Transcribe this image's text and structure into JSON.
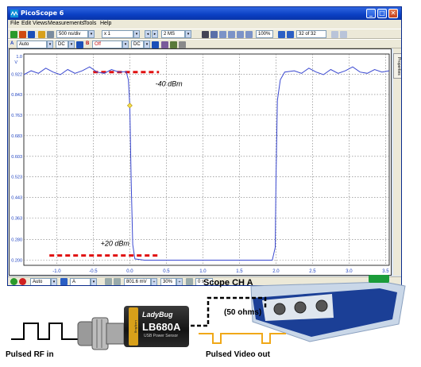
{
  "window": {
    "title": "PicoScope 6",
    "buttons": [
      "_",
      "□",
      "✕"
    ]
  },
  "menu": [
    "File",
    "Edit",
    "Views",
    "Measurements",
    "Tools",
    "Help"
  ],
  "toolbar1": {
    "timebase": "500 ns/div",
    "zoom": "x 1",
    "samples": "2 MS",
    "zoom_percent": "100%",
    "capture_counter": "32 of 32"
  },
  "toolbar2": {
    "channel_a_label": "A",
    "channel_a_range": "Auto",
    "channel_a_coupling": "DC",
    "channel_b_label": "B",
    "channel_b_range": "Off",
    "channel_b_coupling": "DC"
  },
  "side_tab": "Properties",
  "statusbar": {
    "trigger_mode": "Auto",
    "trigger_channel": "A",
    "trigger_level": "801.6 mV",
    "pretrigger": "30%",
    "delay": "0 s"
  },
  "chart_data": {
    "type": "line",
    "x_ticks": [
      "-1.0",
      "-0.5",
      "0.0",
      "0.5",
      "1.0",
      "1.5",
      "2.0",
      "2.5",
      "3.0",
      "3.5"
    ],
    "y_ticks": [
      "0.922",
      "0.843",
      "0.763",
      "0.683",
      "0.603",
      "0.523",
      "0.443",
      "0.363",
      "0.280",
      "0.200"
    ],
    "y_top_label": "1.0",
    "y_unit": "V",
    "xlim": [
      -1.45,
      3.55
    ],
    "ylim": [
      0.18,
      1.0
    ],
    "grid": true,
    "series": [
      {
        "color": "#3a48d0",
        "x": [
          -1.45,
          -1.35,
          -1.25,
          -1.15,
          -1.05,
          -0.95,
          -0.85,
          -0.75,
          -0.65,
          -0.55,
          -0.45,
          -0.35,
          -0.25,
          -0.15,
          -0.05,
          -0.02,
          0.0,
          0.02,
          0.04,
          0.07,
          0.2,
          0.6,
          1.0,
          1.5,
          1.95,
          1.99,
          2.0,
          2.02,
          2.06,
          2.12,
          2.25,
          2.35,
          2.45,
          2.55,
          2.65,
          2.75,
          2.85,
          2.95,
          3.05,
          3.15,
          3.25,
          3.35,
          3.45,
          3.55
        ],
        "y": [
          0.92,
          0.935,
          0.925,
          0.945,
          0.93,
          0.92,
          0.94,
          0.925,
          0.935,
          0.95,
          0.93,
          0.925,
          0.94,
          0.93,
          0.932,
          0.9,
          0.8,
          0.5,
          0.26,
          0.205,
          0.2,
          0.2,
          0.2,
          0.2,
          0.2,
          0.25,
          0.5,
          0.82,
          0.9,
          0.93,
          0.935,
          0.925,
          0.945,
          0.93,
          0.92,
          0.94,
          0.925,
          0.935,
          0.95,
          0.93,
          0.925,
          0.94,
          0.93,
          0.935
        ]
      }
    ],
    "annotations": [
      {
        "text": "-40 dBm",
        "x": 0.35,
        "y": 0.875
      },
      {
        "text": "+20 dBm",
        "x": -0.4,
        "y": 0.255
      }
    ],
    "reference_lines": [
      {
        "color": "#e01010",
        "x": [
          -0.5,
          0.4
        ],
        "y": 0.93
      },
      {
        "color": "#e01010",
        "x": [
          -1.1,
          0.4
        ],
        "y": 0.218
      }
    ],
    "trigger_marker": {
      "x": 0.0,
      "y": 0.8
    }
  },
  "hardware": {
    "scope_label": "Scope CH A",
    "impedance_label": "(50 ohms)",
    "input_label": "Pulsed RF in",
    "output_label": "Pulsed Video out",
    "sensor_brand": "LadyBug",
    "sensor_model": "LB680A",
    "sensor_desc": "USB Power Sensor",
    "sensor_band": "LadyBug"
  }
}
